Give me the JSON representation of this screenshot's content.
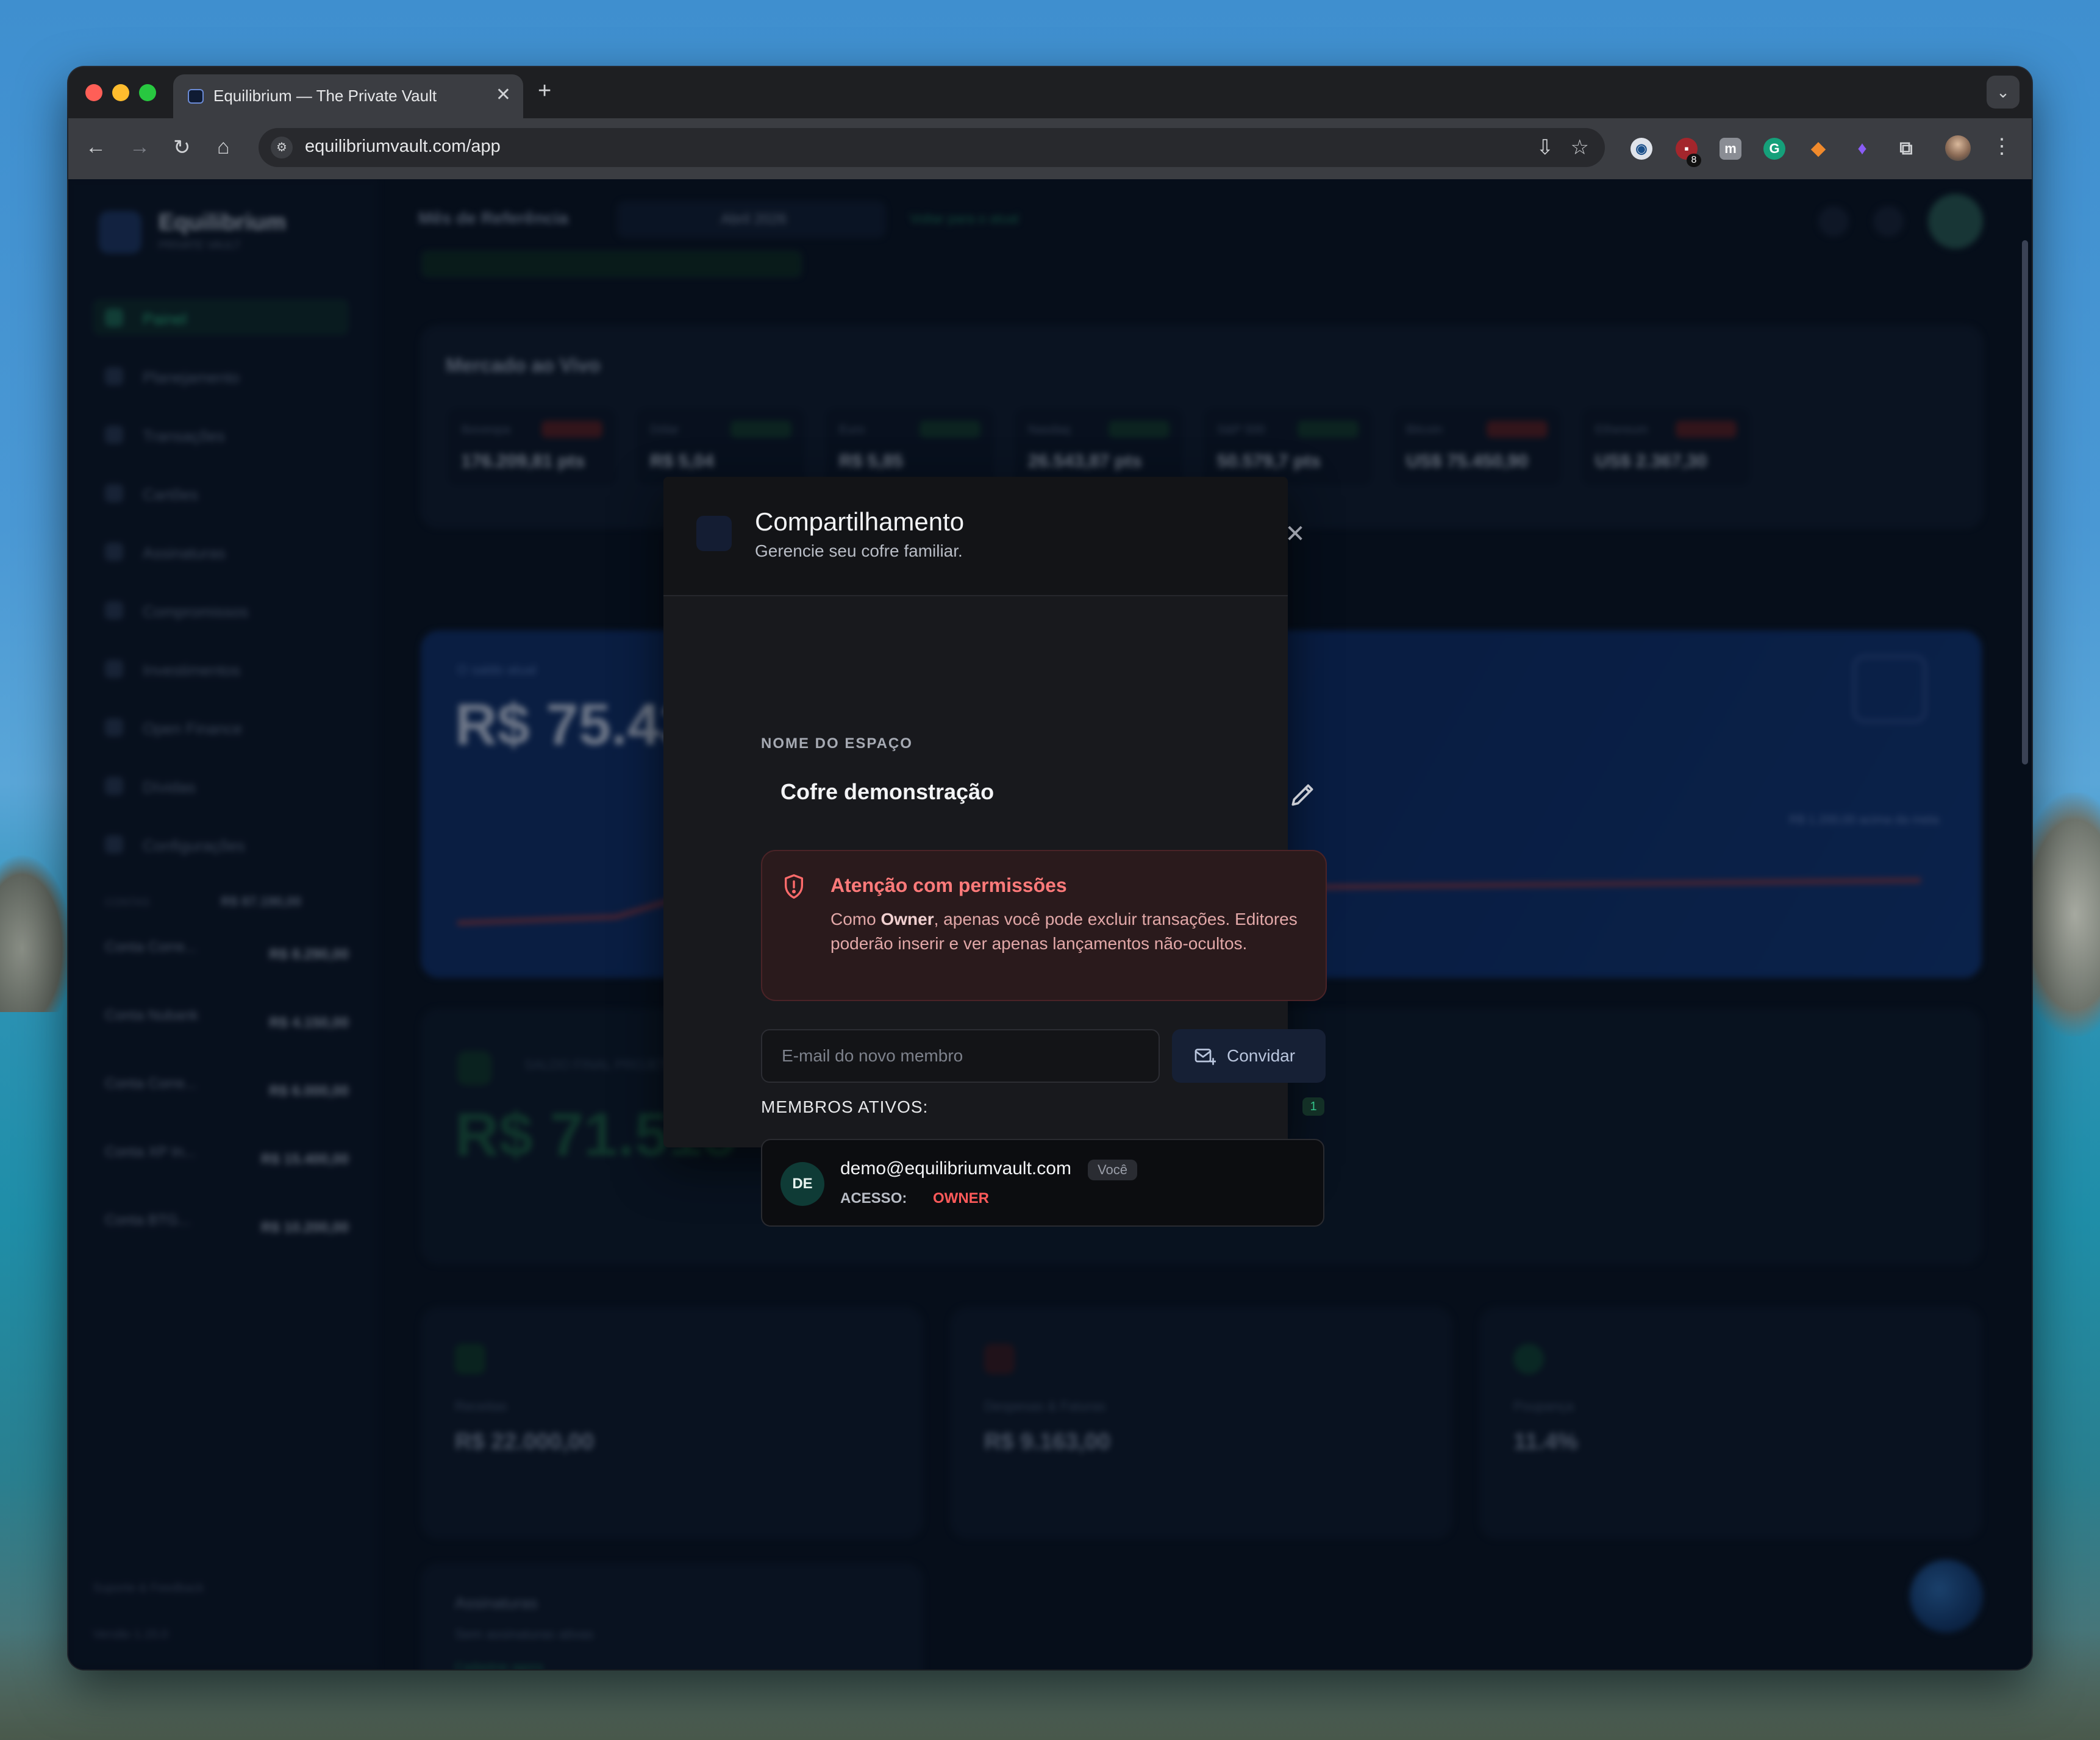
{
  "browser": {
    "tab_title": "Equilibrium — The Private Vault",
    "url": "equilibriumvault.com/app",
    "extension_badge": "8"
  },
  "app_background": {
    "brand": "Equilibrium",
    "brand_sub": "PRIVATE VAULT",
    "nav": [
      "Painel",
      "Planejamento",
      "Transações",
      "Cartões",
      "Assinaturas",
      "Compromissos",
      "Investimentos",
      "Open Finance",
      "Dívidas",
      "Configurações"
    ],
    "accounts_label": "CONTAS",
    "accounts_total": "R$ 87.190,00",
    "accounts": [
      {
        "name": "Conta Corre...",
        "value": "R$ 8.290,00"
      },
      {
        "name": "Conta Nubank",
        "value": "R$ 4.150,00"
      },
      {
        "name": "Conta Corre...",
        "value": "R$ 6.000,00"
      },
      {
        "name": "Conta XP In...",
        "value": "R$ 15.400,00"
      },
      {
        "name": "Conta BTG...",
        "value": "R$ 10.200,00"
      }
    ],
    "footer_support": "Suporte & Feedback",
    "footer_version": "Versão 1.15.0",
    "topbar_title": "Mês de Referência",
    "month": "Abril 2026",
    "back_link": "Voltar para o atual",
    "market_title": "Mercado ao Vivo",
    "market": [
      {
        "label": "Ibovespa",
        "value": "176.209,81 pts",
        "chg_color": "#5a1f24"
      },
      {
        "label": "Dólar",
        "value": "R$ 5,04",
        "chg_color": "#143a2c"
      },
      {
        "label": "Euro",
        "value": "R$ 5,85",
        "chg_color": "#143a2c"
      },
      {
        "label": "Nasdaq",
        "value": "26.543,87 pts",
        "chg_color": "#143a2c"
      },
      {
        "label": "S&P 500",
        "value": "50.579,7 pts",
        "chg_color": "#143a2c"
      },
      {
        "label": "Bitcoin",
        "value": "US$ 75.450,90",
        "chg_color": "#5a1f24"
      },
      {
        "label": "Ethereum",
        "value": "US$ 2.367,30",
        "chg_color": "#5a1f24"
      }
    ],
    "balance_label": "O saldo atual",
    "balance_value": "R$ 75.439,",
    "balance_note": "R$ 1.200,00 acima da meta",
    "projection_label": "SALDO FINAL PROJETADO",
    "projection_value": "R$ 71.515",
    "stats": [
      {
        "label": "Receitas",
        "value": "R$ 22.000,00",
        "icon_color": "#113a2a"
      },
      {
        "label": "Despesas & Faturas",
        "value": "R$ 9.163,00",
        "icon_color": "#3a1a22"
      },
      {
        "label": "Poupança",
        "value": "11.4%",
        "icon_color": "#124234"
      }
    ],
    "signatures_title": "Assinaturas",
    "signatures_sub": "Sem assinaturas ativas",
    "signatures_link": "Cadastrar agora"
  },
  "modal": {
    "title": "Compartilhamento",
    "subtitle": "Gerencie seu cofre familiar.",
    "space_label": "NOME DO ESPAÇO",
    "space_name": "Cofre demonstração",
    "warning_title": "Atenção com permissões",
    "warning_prefix": "Como ",
    "warning_role": "Owner",
    "warning_rest": ", apenas você pode excluir transações. Editores poderão inserir e ver apenas lançamentos não-ocultos.",
    "email_placeholder": "E-mail do novo membro",
    "invite_label": "Convidar",
    "members_label": "MEMBROS ATIVOS:",
    "members_count": "1",
    "members": [
      {
        "initials": "DE",
        "email": "demo@equilibriumvault.com",
        "badge": "Você",
        "access_label": "ACESSO:",
        "access_value": "OWNER"
      }
    ]
  }
}
